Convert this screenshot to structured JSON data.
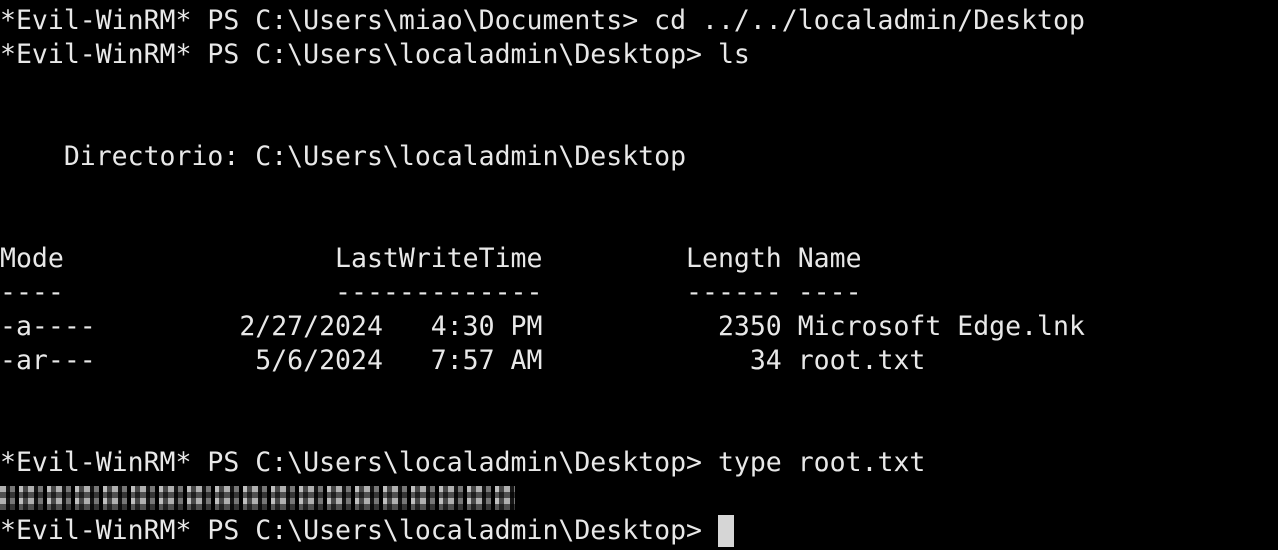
{
  "terminal": {
    "lines": {
      "cmd_cd": "*Evil-WinRM* PS C:\\Users\\miao\\Documents> cd ../../localadmin/Desktop",
      "cmd_ls": "*Evil-WinRM* PS C:\\Users\\localadmin\\Desktop> ls",
      "directory": "    Directorio: C:\\Users\\localadmin\\Desktop",
      "header": "Mode                 LastWriteTime         Length Name",
      "underline": "----                 -------------         ------ ----",
      "row_1": "-a----         2/27/2024   4:30 PM           2350 Microsoft Edge.lnk",
      "row_2": "-ar---          5/6/2024   7:57 AM             34 root.txt",
      "cmd_type": "*Evil-WinRM* PS C:\\Users\\localadmin\\Desktop> type root.txt",
      "prompt": "*Evil-WinRM* PS C:\\Users\\localadmin\\Desktop> "
    },
    "colors": {
      "background": "#000000",
      "foreground": "#e8e8e8",
      "cursor": "#d6d6d6"
    }
  }
}
